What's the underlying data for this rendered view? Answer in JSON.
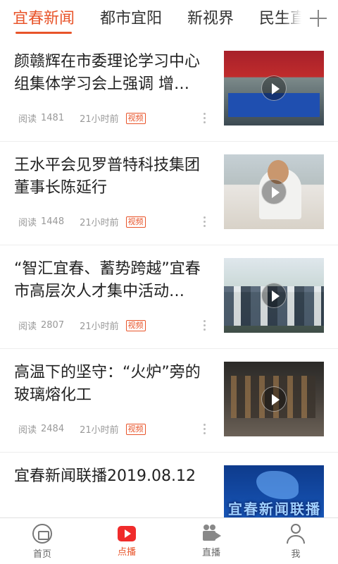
{
  "tabs": [
    {
      "label": "宜春新闻",
      "active": true
    },
    {
      "label": "都市宜阳",
      "active": false
    },
    {
      "label": "新视界",
      "active": false
    },
    {
      "label": "民生直",
      "active": false
    }
  ],
  "add_icon": "plus-icon",
  "news": [
    {
      "title": "颜赣辉在市委理论学习中心组集体学习会上强调  增…",
      "reads_label": "阅读",
      "reads": "1481",
      "time": "21小时前",
      "badge": "视频"
    },
    {
      "title": "王水平会见罗普特科技集团董事长陈延行",
      "reads_label": "阅读",
      "reads": "1448",
      "time": "21小时前",
      "badge": "视频"
    },
    {
      "title": "“智汇宜春、蓄势跨越”宜春市高层次人才集中活动…",
      "reads_label": "阅读",
      "reads": "2807",
      "time": "21小时前",
      "badge": "视频"
    },
    {
      "title": "高温下的坚守：“火炉”旁的玻璃熔化工",
      "reads_label": "阅读",
      "reads": "2484",
      "time": "21小时前",
      "badge": "视频"
    },
    {
      "title": "宜春新闻联播2019.08.12",
      "reads_label": "",
      "reads": "",
      "time": "",
      "badge": ""
    }
  ],
  "thumb_logo": "宜春新闻联播",
  "bottom_nav": [
    {
      "label": "首页",
      "icon": "home-icon",
      "active": false
    },
    {
      "label": "点播",
      "icon": "play-icon",
      "active": true
    },
    {
      "label": "直播",
      "icon": "video-camera-icon",
      "active": false
    },
    {
      "label": "我",
      "icon": "user-icon",
      "active": false
    }
  ],
  "colors": {
    "accent": "#e8542a",
    "play_red": "#f02b2b"
  }
}
